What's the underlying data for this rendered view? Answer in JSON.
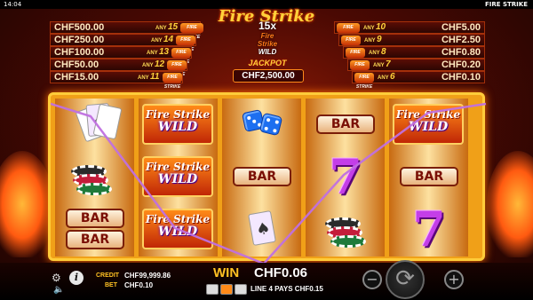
{
  "statusbar": {
    "time": "14:04",
    "game_name": "FIRE STRIKE"
  },
  "logo": {
    "text": "Fire Strike"
  },
  "paytable": {
    "left": [
      {
        "amount": "CHF500.00",
        "any_label": "ANY",
        "count": "15"
      },
      {
        "amount": "CHF250.00",
        "any_label": "ANY",
        "count": "14"
      },
      {
        "amount": "CHF100.00",
        "any_label": "ANY",
        "count": "13"
      },
      {
        "amount": "CHF50.00",
        "any_label": "ANY",
        "count": "12"
      },
      {
        "amount": "CHF15.00",
        "any_label": "ANY",
        "count": "11"
      }
    ],
    "right": [
      {
        "amount": "CHF5.00",
        "any_label": "ANY",
        "count": "10"
      },
      {
        "amount": "CHF2.50",
        "any_label": "ANY",
        "count": "9"
      },
      {
        "amount": "CHF0.80",
        "any_label": "ANY",
        "count": "8"
      },
      {
        "amount": "CHF0.20",
        "any_label": "ANY",
        "count": "7"
      },
      {
        "amount": "CHF0.10",
        "any_label": "ANY",
        "count": "6"
      }
    ],
    "multiplier": "15x",
    "center_logo_top": "Fire",
    "center_logo_mid": "Strike",
    "center_logo_wild": "WILD",
    "jackpot_label": "JACKPOT",
    "jackpot_value": "CHF2,500.00",
    "mini_icon_text": "FIRE STRIKE"
  },
  "reels": {
    "bar_text": "BAR",
    "wild_top": "Fire Strike",
    "wild_bottom": "WILD"
  },
  "footer": {
    "credit_label": "CREDIT",
    "credit_value": "CHF99,999.86",
    "bet_label": "BET",
    "bet_value": "CHF0.10",
    "win_label": "WIN",
    "win_value": "CHF0.06",
    "line_win_text": "LINE 4 PAYS CHF0.15",
    "settings_icon": "gear-icon",
    "info_icon": "info-icon",
    "sound_icon": "speaker-icon",
    "minus_label": "−",
    "plus_label": "+",
    "spin_icon": "spin-arrows-icon"
  },
  "colors": {
    "accent": "#ffc223",
    "reel_frame": "#f0a018",
    "seven": "#c43ee8",
    "win_line": "#c070e0"
  }
}
